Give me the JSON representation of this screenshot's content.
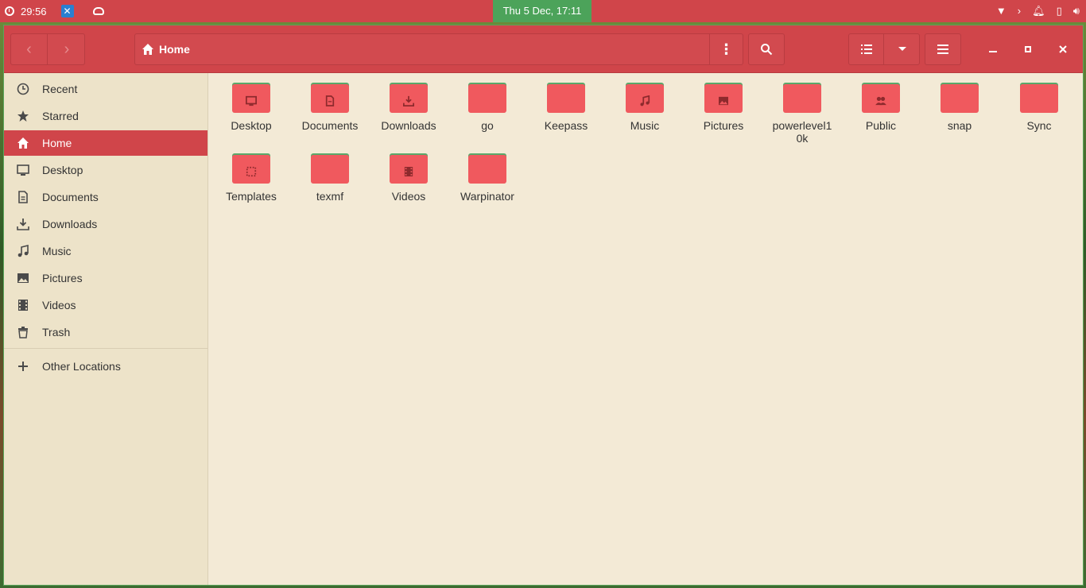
{
  "top_panel": {
    "left_time": "29:56",
    "datetime": "Thu  5 Dec, 17:11"
  },
  "colors": {
    "accent": "#d0454a",
    "folder": "#f0595e",
    "folder_tab": "#5aa86a",
    "background": "#f3ead6",
    "sidebar": "#ede3c9"
  },
  "path": {
    "current": "Home",
    "icon": "home-icon"
  },
  "sidebar": {
    "items": [
      {
        "label": "Recent",
        "icon": "clock-icon"
      },
      {
        "label": "Starred",
        "icon": "star-icon"
      },
      {
        "label": "Home",
        "icon": "home-icon",
        "active": true
      },
      {
        "label": "Desktop",
        "icon": "desktop-icon"
      },
      {
        "label": "Documents",
        "icon": "document-icon"
      },
      {
        "label": "Downloads",
        "icon": "download-icon"
      },
      {
        "label": "Music",
        "icon": "music-icon"
      },
      {
        "label": "Pictures",
        "icon": "picture-icon"
      },
      {
        "label": "Videos",
        "icon": "video-icon"
      },
      {
        "label": "Trash",
        "icon": "trash-icon"
      }
    ],
    "other_locations": "Other Locations"
  },
  "files": [
    {
      "name": "Desktop",
      "emblem": "desktop-icon"
    },
    {
      "name": "Documents",
      "emblem": "document-icon"
    },
    {
      "name": "Downloads",
      "emblem": "download-icon"
    },
    {
      "name": "go",
      "emblem": ""
    },
    {
      "name": "Keepass",
      "emblem": ""
    },
    {
      "name": "Music",
      "emblem": "music-icon"
    },
    {
      "name": "Pictures",
      "emblem": "picture-icon"
    },
    {
      "name": "powerlevel1\n0k",
      "emblem": ""
    },
    {
      "name": "Public",
      "emblem": "people-icon"
    },
    {
      "name": "snap",
      "emblem": ""
    },
    {
      "name": "Sync",
      "emblem": ""
    },
    {
      "name": "Templates",
      "emblem": "template-icon"
    },
    {
      "name": "texmf",
      "emblem": ""
    },
    {
      "name": "Videos",
      "emblem": "video-icon"
    },
    {
      "name": "Warpinator",
      "emblem": ""
    }
  ]
}
